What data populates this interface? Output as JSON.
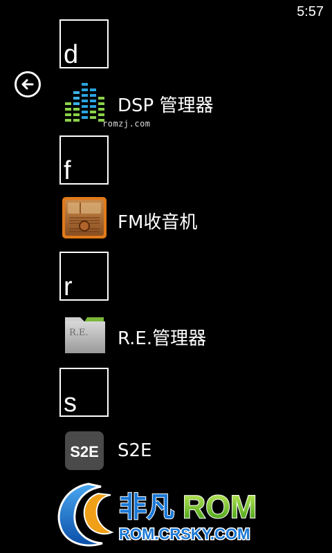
{
  "status_bar": {
    "time": "5:57"
  },
  "letters": {
    "d": "d",
    "f": "f",
    "r": "r",
    "s": "s"
  },
  "apps": {
    "dsp": {
      "label": "DSP 管理器",
      "icon": "equalizer-icon"
    },
    "fm": {
      "label": "FM收音机",
      "icon": "radio-icon"
    },
    "re": {
      "label": "R.E.管理器",
      "icon": "folder-icon"
    },
    "s2e": {
      "label": "S2E",
      "icon": "s2e-icon",
      "icon_text": "S2E"
    }
  },
  "watermarks": {
    "romzj": "romzj.com",
    "logo_cn": "非凡",
    "logo_rom": "ROM",
    "logo_url": "ROM.CRSKY.COM"
  },
  "colors": {
    "background": "#000000",
    "foreground": "#ffffff",
    "logo_green": "#7ccf1a",
    "logo_blue": "#1a78d6"
  }
}
